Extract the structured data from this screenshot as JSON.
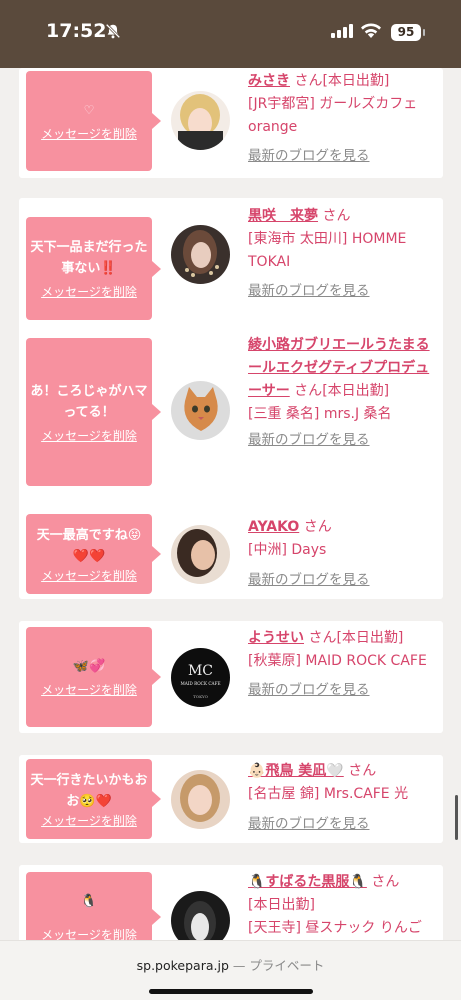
{
  "status": {
    "time": "17:52",
    "battery": "95"
  },
  "browser": {
    "domain": "sp.pokepara.jp",
    "mode": "— プライベート"
  },
  "cards": [
    {
      "message": "♡",
      "delete_label": "メッセージを削除",
      "name": "みさき",
      "san": " さん",
      "status": "[本日出勤]",
      "shop": "[JR宇都宮] ガールズカフェorange",
      "blog": "最新のブログを見る"
    },
    {
      "message": "天下一品まだ行った事ない‼️",
      "delete_label": "メッセージを削除",
      "name": "黒咲　来夢",
      "san": " さん",
      "status": "",
      "shop": "[東海市 太田川] HOMME TOKAI",
      "blog": "最新のブログを見る"
    },
    {
      "message": "あ！ころじゃがハマってる！",
      "delete_label": "メッセージを削除",
      "name": "綾小路ガブリエールうたまるールエクゼグティブプロデューサー",
      "san": " さん",
      "status": "[本日出勤]",
      "shop": "[三重 桑名] mrs.J 桑名",
      "blog": "最新のブログを見る"
    },
    {
      "message": "天一最高ですね😝❤️❤️",
      "delete_label": "メッセージを削除",
      "name": "AYAKO",
      "san": " さん",
      "status": "",
      "shop": "[中洲] Days",
      "blog": "最新のブログを見る"
    },
    {
      "message": "🦋💞",
      "delete_label": "メッセージを削除",
      "name": "ようせい",
      "san": " さん",
      "status": "[本日出勤]",
      "shop": "[秋葉原] MAID ROCK CAFE",
      "blog": "最新のブログを見る"
    },
    {
      "message": "天一行きたいかもおお🥺❤️",
      "delete_label": "メッセージを削除",
      "name": "👶🏻飛鳥 美凪🤍",
      "san": " さん",
      "status": "",
      "shop": "[名古屋 錦] Mrs.CAFE 光",
      "blog": "最新のブログを見る"
    },
    {
      "message": "🐧",
      "delete_label": "メッセージを削除",
      "name": "🐧すばるた黒服🐧",
      "san": " さん",
      "status": "[本日出勤]",
      "shop": "[天王寺] 昼スナック りんご",
      "blog": ""
    }
  ]
}
